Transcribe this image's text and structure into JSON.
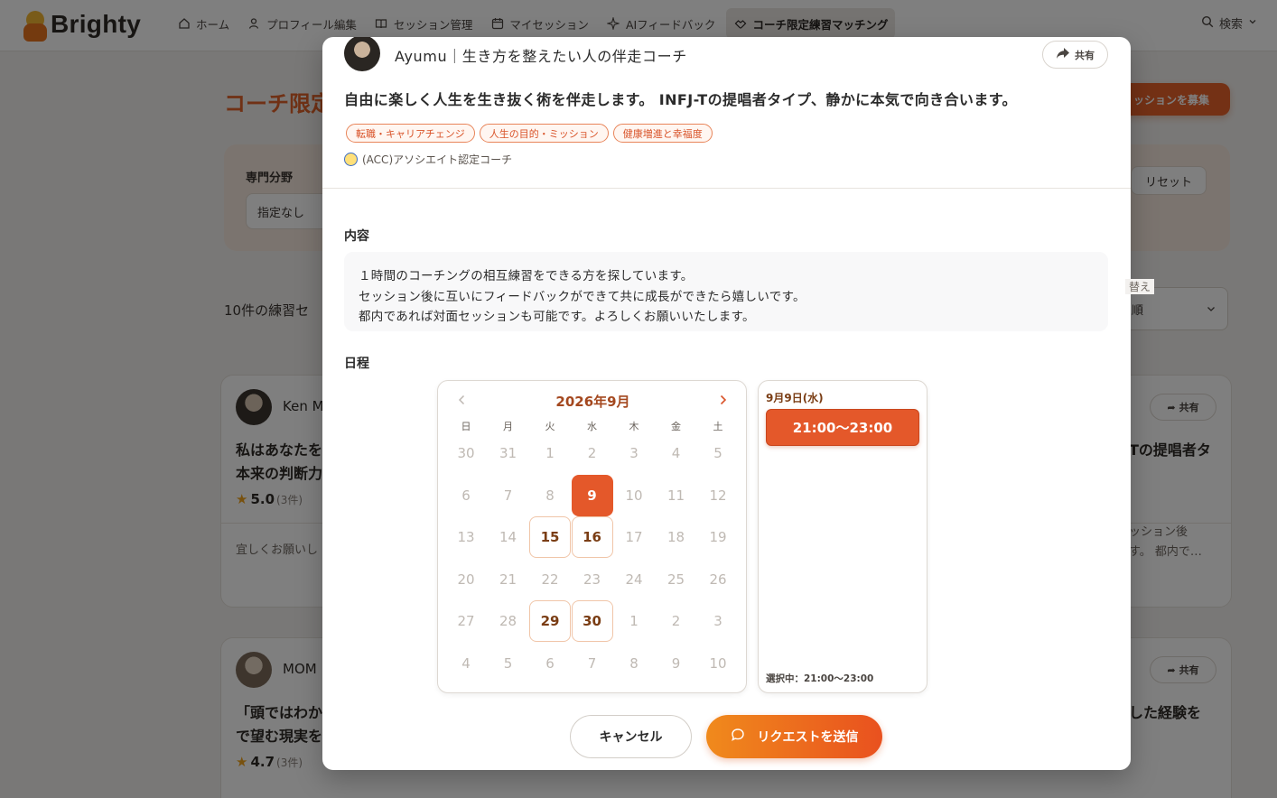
{
  "app": {
    "logo_text": "Brighty",
    "nav": [
      "ホーム",
      "プロフィール編集",
      "セッション管理",
      "マイセッション",
      "AIフィードバック",
      "コーチ限定練習マッチング"
    ],
    "search_label": "検索"
  },
  "background": {
    "page_title": "コーチ限定",
    "recruit_button": "ッションを募集",
    "filter_label": "専門分野",
    "filter_value": "指定なし",
    "reset_button": "リセット",
    "count_text": "10件の練習セ",
    "sort_label": "替え",
    "sort_value": "順",
    "cards": [
      {
        "name": "Ken M",
        "line1": "私はあなたを",
        "line2": "本来の判断力",
        "rating": "5.0",
        "rating_count": "(3件)",
        "snippet": "宜しくお願いし",
        "right_line": "Tの提唱者タ",
        "right_snippet1": "ッション後",
        "right_snippet2": "す。 都内で…",
        "share": "共有"
      },
      {
        "name": "MOM",
        "line1": "「頭ではわか",
        "line2": "で望む現実を",
        "rating": "4.7",
        "rating_count": "(3件)",
        "right_line": "した経験を",
        "share": "共有"
      }
    ]
  },
  "modal": {
    "coach_title": "Ayumu｜生き方を整えたい人の伴走コーチ",
    "share_label": "共有",
    "headline": "自由に楽しく人生を生き抜く術を伴走します。 INFJ-Tの提唱者タイプ、静かに本気で向き合います。",
    "tags": [
      "転職・キャリアチェンジ",
      "人生の目的・ミッション",
      "健康増進と幸福度"
    ],
    "certification": "(ACC)アソシエイト認定コーチ",
    "content_label": "内容",
    "content_lines": [
      "１時間のコーチングの相互練習をできる方を探しています。",
      "セッション後に互いにフィードバックができて共に成長ができたら嬉しいです。",
      "都内であれば対面セッションも可能です。よろしくお願いいたします。"
    ],
    "schedule_label": "日程",
    "calendar": {
      "month_title": "2026年9月",
      "weekdays": [
        "日",
        "月",
        "火",
        "水",
        "木",
        "金",
        "土"
      ],
      "weeks": [
        [
          "30",
          "31",
          "1",
          "2",
          "3",
          "4",
          "5"
        ],
        [
          "6",
          "7",
          "8",
          "9",
          "10",
          "11",
          "12"
        ],
        [
          "13",
          "14",
          "15",
          "16",
          "17",
          "18",
          "19"
        ],
        [
          "20",
          "21",
          "22",
          "23",
          "24",
          "25",
          "26"
        ],
        [
          "27",
          "28",
          "29",
          "30",
          "1",
          "2",
          "3"
        ],
        [
          "4",
          "5",
          "6",
          "7",
          "8",
          "9",
          "10"
        ]
      ],
      "available_days": [
        "15",
        "16",
        "29",
        "30"
      ],
      "selected_day": "9"
    },
    "slots": {
      "date_label": "9月9日(水)",
      "times": [
        "21:00〜23:00"
      ],
      "selected_text": "選択中：21:00〜23:00"
    },
    "cancel_button": "キャンセル",
    "send_button": "リクエストを送信",
    "accent_color": "#e4582a"
  }
}
